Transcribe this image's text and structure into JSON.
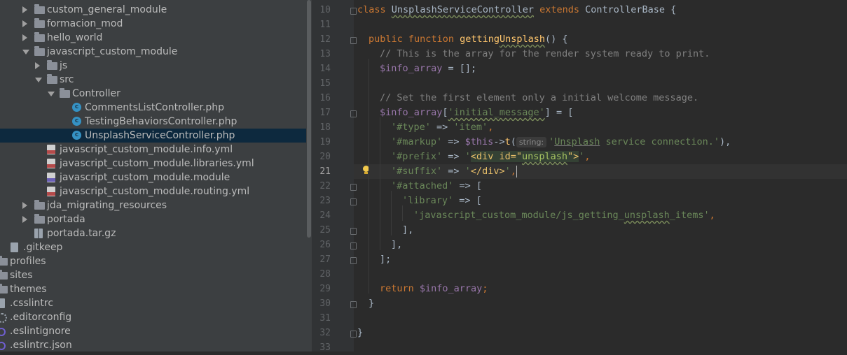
{
  "project_tree": {
    "items": [
      {
        "label": "custom_general_module",
        "icon": "folder-icon",
        "expanded": false,
        "level": 1
      },
      {
        "label": "formacion_mod",
        "icon": "folder-icon",
        "expanded": false,
        "level": 1
      },
      {
        "label": "hello_world",
        "icon": "folder-icon",
        "expanded": false,
        "level": 1
      },
      {
        "label": "javascript_custom_module",
        "icon": "folder-icon",
        "expanded": true,
        "level": 1
      },
      {
        "label": "js",
        "icon": "folder-icon",
        "expanded": false,
        "level": 2
      },
      {
        "label": "src",
        "icon": "folder-icon",
        "expanded": true,
        "level": 2
      },
      {
        "label": "Controller",
        "icon": "folder-icon",
        "expanded": true,
        "level": 3
      },
      {
        "label": "CommentsListController.php",
        "icon": "php-class-icon",
        "level": 4
      },
      {
        "label": "TestingBehaviorsController.php",
        "icon": "php-class-icon",
        "level": 4
      },
      {
        "label": "UnsplashServiceController.php",
        "icon": "php-class-icon",
        "level": 4,
        "selected": true
      },
      {
        "label": "javascript_custom_module.info.yml",
        "icon": "yml-file-icon",
        "level": 2
      },
      {
        "label": "javascript_custom_module.libraries.yml",
        "icon": "yml-file-icon",
        "level": 2
      },
      {
        "label": "javascript_custom_module.module",
        "icon": "php-file-icon",
        "level": 2
      },
      {
        "label": "javascript_custom_module.routing.yml",
        "icon": "yml-file-icon",
        "level": 2
      },
      {
        "label": "jda_migrating_resources",
        "icon": "folder-icon",
        "expanded": false,
        "level": 1
      },
      {
        "label": "portada",
        "icon": "folder-icon",
        "expanded": false,
        "level": 1
      },
      {
        "label": "portada.tar.gz",
        "icon": "archive-icon",
        "level": 1
      },
      {
        "label": ".gitkeep",
        "icon": "file-icon",
        "level": 0
      },
      {
        "label": "profiles",
        "icon": "folder-icon",
        "level": -1
      },
      {
        "label": "sites",
        "icon": "folder-icon",
        "level": -1
      },
      {
        "label": "themes",
        "icon": "folder-icon",
        "level": -1
      },
      {
        "label": ".csslintrc",
        "icon": "file-icon",
        "level": -1
      },
      {
        "label": ".editorconfig",
        "icon": "gear-icon",
        "level": -1
      },
      {
        "label": ".eslintignore",
        "icon": "eslint-icon",
        "level": -1
      },
      {
        "label": ".eslintrc.json",
        "icon": "eslint-icon",
        "level": -1
      }
    ]
  },
  "editor": {
    "current_line": "21",
    "line_numbers": [
      "10",
      "11",
      "12",
      "13",
      "14",
      "15",
      "16",
      "17",
      "18",
      "19",
      "20",
      "21",
      "22",
      "23",
      "24",
      "25",
      "26",
      "27",
      "28",
      "29",
      "30",
      "31",
      "32",
      "33"
    ],
    "code": {
      "l10": {
        "kw1": "class",
        "name": "UnsplashServiceController",
        "kw2": "extends",
        "base": "ControllerBase",
        "brace": "{"
      },
      "l12": {
        "kw1": "public",
        "kw2": "function",
        "fn1": "getting",
        "fn2": "Unsplash",
        "rest": "() {"
      },
      "l13": {
        "comment": "// This is the array for the render system ready to print."
      },
      "l14": {
        "var": "$info_array",
        "rest": " = [];"
      },
      "l16": {
        "comment": "// Set the first element only a initial welcome message."
      },
      "l17": {
        "var": "$info_array",
        "p1": "[",
        "s1": "'initial_message'",
        "rest": "] = ["
      },
      "l18": {
        "s1": "'#type'",
        "op": " => ",
        "s2": "'item'",
        "rest": ","
      },
      "l19": {
        "s1": "'#markup'",
        "op": " => ",
        "var": "$this",
        "arrow": "->",
        "fn": "t",
        "p1": "(",
        "hint": "string:",
        "s2a": "'",
        "s2b": "Unsplash",
        "s2c": " service connection.'",
        "rest": "),"
      },
      "l20": {
        "s1": "'#prefix'",
        "op": " => ",
        "q1": "'",
        "tag": "<div id=\"",
        "attr": "unsplash",
        "tagend": "\">",
        "q2": "'",
        "rest": ","
      },
      "l21": {
        "s1": "'#suffix'",
        "op": " => ",
        "q1": "'",
        "tag": "</div>",
        "q2": "'",
        "rest": ","
      },
      "l22": {
        "s1": "'#attached'",
        "rest": " => ["
      },
      "l23": {
        "s1": "'library'",
        "rest": " => ["
      },
      "l24": {
        "s1": "'javascript_custom_module/js_getting_",
        "s2": "unsplash",
        "s3": "_items'",
        "rest": ","
      },
      "l25": {
        "rest": "],"
      },
      "l26": {
        "rest": "],"
      },
      "l27": {
        "rest": "];"
      },
      "l29": {
        "kw": "return",
        "var": " $info_array",
        "rest": ";"
      },
      "l30": {
        "rest": "}"
      },
      "l32": {
        "rest": "}"
      }
    }
  }
}
